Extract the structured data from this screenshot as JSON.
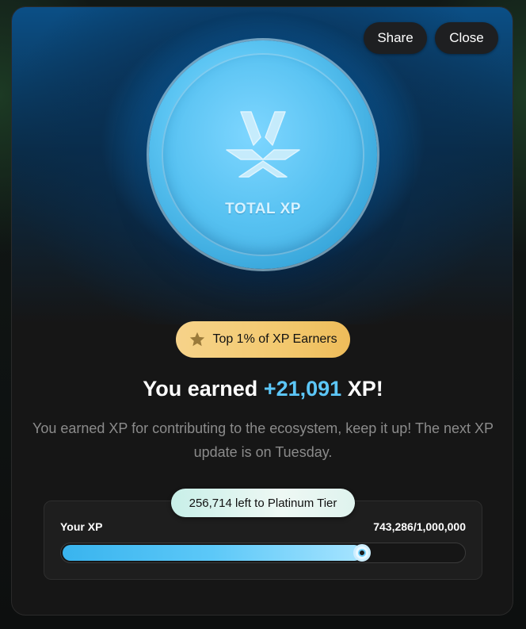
{
  "header": {
    "share_label": "Share",
    "close_label": "Close"
  },
  "coin": {
    "icon": "xp-logo-icon",
    "label": "TOTAL XP"
  },
  "badge": {
    "icon": "star-icon",
    "label": "Top 1% of XP Earners"
  },
  "headline": {
    "prefix": "You earned",
    "amount": "+21,091",
    "suffix": "XP!"
  },
  "description": "You earned XP for contributing to the ecosystem, keep it up! The next XP update is on Tuesday.",
  "progress": {
    "remaining_label": "256,714 left to Platinum Tier",
    "label": "Your XP",
    "value_text": "743,286/1,000,000",
    "current": 743286,
    "target": 1000000
  },
  "colors": {
    "accent": "#5cc6f7",
    "badge_gold": "#f3c96f"
  }
}
